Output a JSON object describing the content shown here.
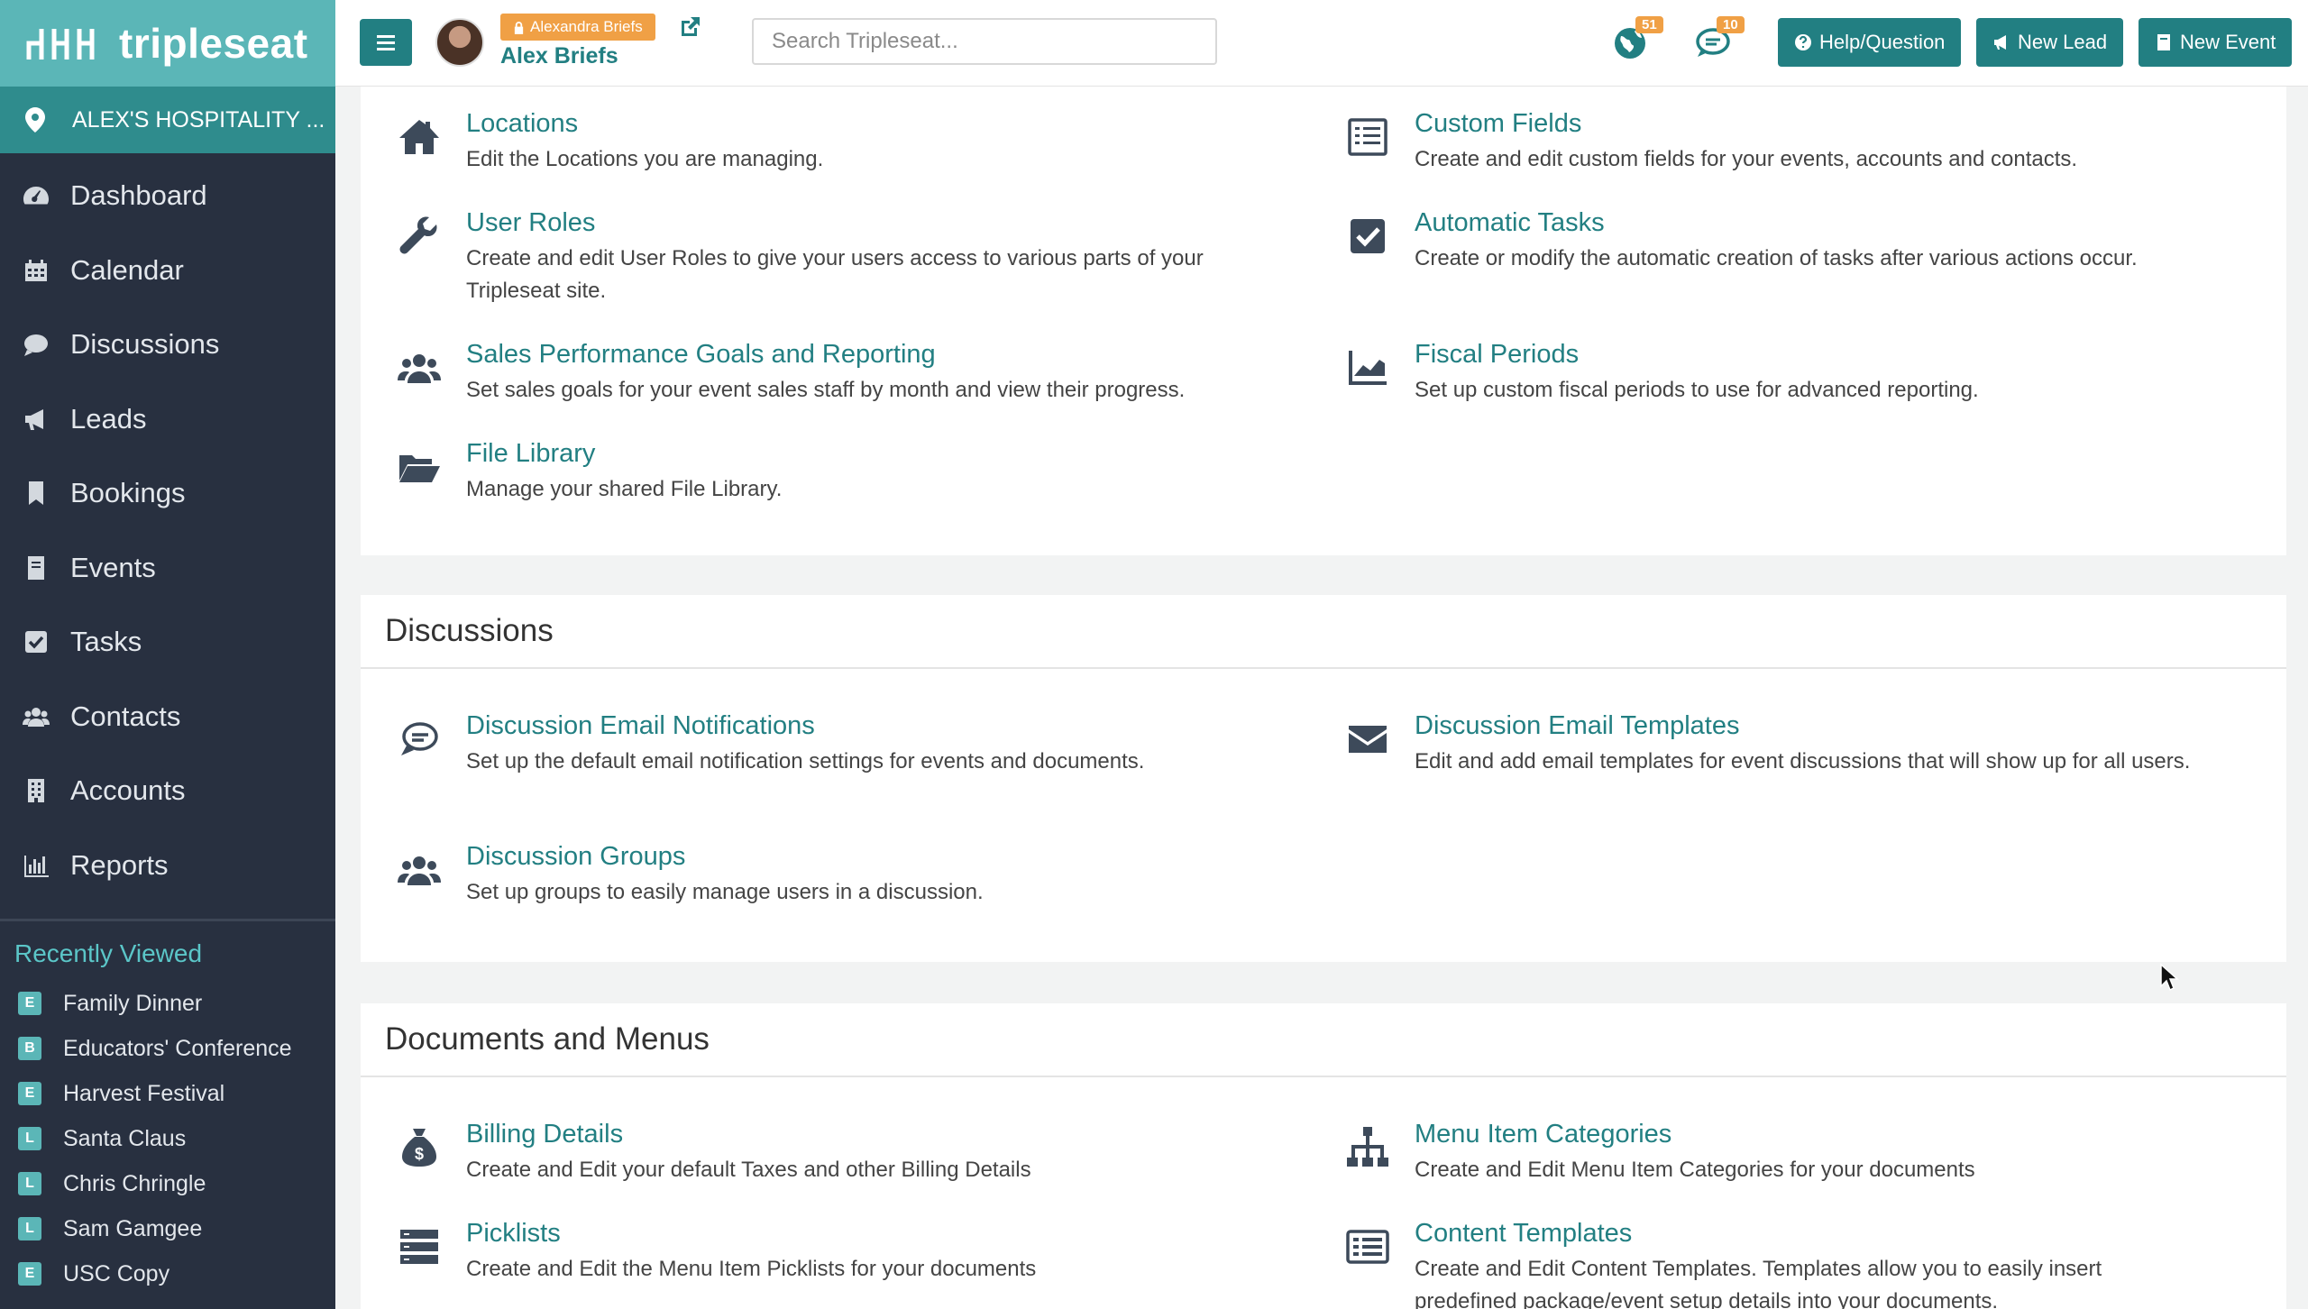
{
  "brand": {
    "name": "tripleseat",
    "color": "#5bb6b7"
  },
  "venue": {
    "label": "ALEX'S HOSPITALITY ..."
  },
  "nav": [
    {
      "label": "Dashboard",
      "icon": "dashboard-icon"
    },
    {
      "label": "Calendar",
      "icon": "calendar-icon"
    },
    {
      "label": "Discussions",
      "icon": "chat-icon"
    },
    {
      "label": "Leads",
      "icon": "megaphone-icon"
    },
    {
      "label": "Bookings",
      "icon": "bookmark-icon"
    },
    {
      "label": "Events",
      "icon": "book-icon"
    },
    {
      "label": "Tasks",
      "icon": "checkbox-icon"
    },
    {
      "label": "Contacts",
      "icon": "users-icon"
    },
    {
      "label": "Accounts",
      "icon": "building-icon"
    },
    {
      "label": "Reports",
      "icon": "bar-chart-icon"
    }
  ],
  "recent": {
    "title": "Recently Viewed",
    "items": [
      {
        "badge": "E",
        "label": "Family Dinner"
      },
      {
        "badge": "B",
        "label": "Educators' Conference"
      },
      {
        "badge": "E",
        "label": "Harvest Festival"
      },
      {
        "badge": "L",
        "label": "Santa Claus"
      },
      {
        "badge": "L",
        "label": "Chris Chringle"
      },
      {
        "badge": "L",
        "label": "Sam Gamgee"
      },
      {
        "badge": "E",
        "label": "USC Copy"
      }
    ]
  },
  "topbar": {
    "user_tag": "Alexandra Briefs",
    "user_name": "Alex Briefs",
    "search_placeholder": "Search Tripleseat...",
    "notif_count_1": "51",
    "notif_count_2": "10",
    "help_label": "Help/Question",
    "new_lead_label": "New Lead",
    "new_event_label": "New Event",
    "accent": "#227f82",
    "badge_color": "#f0a045"
  },
  "sections": {
    "general": {
      "items": [
        {
          "title": "Locations",
          "desc": "Edit the Locations you are managing.",
          "icon": "home-icon"
        },
        {
          "title": "User Roles",
          "desc": "Create and edit User Roles to give your users access to various parts of your Tripleseat site.",
          "icon": "wrench-icon"
        },
        {
          "title": "Sales Performance Goals and Reporting",
          "desc": "Set sales goals for your event sales staff by month and view their progress.",
          "icon": "users-icon"
        },
        {
          "title": "File Library",
          "desc": "Manage your shared File Library.",
          "icon": "folder-open-icon"
        },
        {
          "title": "Custom Fields",
          "desc": "Create and edit custom fields for your events, accounts and contacts.",
          "icon": "list-icon"
        },
        {
          "title": "Automatic Tasks",
          "desc": "Create or modify the automatic creation of tasks after various actions occur.",
          "icon": "checkbox-icon"
        },
        {
          "title": "Fiscal Periods",
          "desc": "Set up custom fiscal periods to use for advanced reporting.",
          "icon": "area-chart-icon"
        }
      ]
    },
    "discussions": {
      "title": "Discussions",
      "items": [
        {
          "title": "Discussion Email Notifications",
          "desc": "Set up the default email notification settings for events and documents.",
          "icon": "chat-outline-icon"
        },
        {
          "title": "Discussion Groups",
          "desc": "Set up groups to easily manage users in a discussion.",
          "icon": "users-icon"
        },
        {
          "title": "Discussion Email Templates",
          "desc": "Edit and add email templates for event discussions that will show up for all users.",
          "icon": "envelope-icon"
        }
      ]
    },
    "documents": {
      "title": "Documents and Menus",
      "items": [
        {
          "title": "Billing Details",
          "desc": "Create and Edit your default Taxes and other Billing Details",
          "icon": "money-bag-icon"
        },
        {
          "title": "Picklists",
          "desc": "Create and Edit the Menu Item Picklists for your documents",
          "icon": "picklist-icon"
        },
        {
          "title": "Menu Item Categories",
          "desc": "Create and Edit Menu Item Categories for your documents",
          "icon": "sitemap-icon"
        },
        {
          "title": "Content Templates",
          "desc": "Create and Edit Content Templates. Templates allow you to easily insert predefined package/event setup details into your documents.",
          "icon": "list-alt-icon"
        }
      ]
    }
  }
}
